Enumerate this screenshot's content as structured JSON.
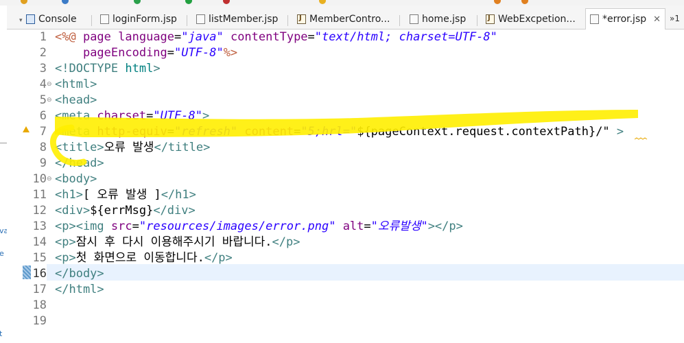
{
  "tabs": [
    {
      "label": "Console",
      "icon": "console-icon"
    },
    {
      "label": "loginForm.jsp",
      "icon": "file-icon"
    },
    {
      "label": "listMember.jsp",
      "icon": "file-icon"
    },
    {
      "label": "MemberContro...",
      "icon": "java-file-icon"
    },
    {
      "label": "home.jsp",
      "icon": "file-icon"
    },
    {
      "label": "WebExcpetion...",
      "icon": "java-file-icon"
    },
    {
      "label": "*error.jsp",
      "icon": "file-icon",
      "close": "✕",
      "active": true
    }
  ],
  "overflow_label": "»1",
  "left_strip": {
    "labels": [
      "va",
      "e",
      "t"
    ]
  },
  "editor": {
    "current_line": 16,
    "lines": [
      {
        "n": "1",
        "tokens": [
          [
            "dir",
            "<%@ "
          ],
          [
            "attr",
            "page "
          ],
          [
            "attr",
            "language"
          ],
          [
            "txt",
            "="
          ],
          [
            "val",
            "\"java\""
          ],
          [
            "txt",
            " "
          ],
          [
            "attr",
            "contentType"
          ],
          [
            "txt",
            "="
          ],
          [
            "val",
            "\"text/html; charset=UTF-8\""
          ]
        ]
      },
      {
        "n": "2",
        "tokens": [
          [
            "txt",
            "    "
          ],
          [
            "attr",
            "pageEncoding"
          ],
          [
            "txt",
            "="
          ],
          [
            "val",
            "\"UTF-8\""
          ],
          [
            "dir",
            "%>"
          ]
        ]
      },
      {
        "n": "3",
        "tokens": [
          [
            "tag",
            "<!DOCTYPE "
          ],
          [
            "doctype",
            "html"
          ],
          [
            "tag",
            ">"
          ]
        ]
      },
      {
        "n": "4",
        "fold": true,
        "tokens": [
          [
            "tag",
            "<html>"
          ]
        ]
      },
      {
        "n": "5",
        "fold": true,
        "tokens": [
          [
            "tag",
            "<head>"
          ]
        ]
      },
      {
        "n": "6",
        "tokens": [
          [
            "tag",
            "<meta "
          ],
          [
            "attr",
            "charset"
          ],
          [
            "txt",
            "="
          ],
          [
            "val",
            "\"UTF-8\""
          ],
          [
            "tag",
            ">"
          ]
        ]
      },
      {
        "n": "7",
        "warn": true,
        "tokens": [
          [
            "tag",
            "<meta "
          ],
          [
            "attr",
            "http-equiv"
          ],
          [
            "txt",
            "="
          ],
          [
            "val",
            "\"refresh\""
          ],
          [
            "txt",
            " "
          ],
          [
            "attr",
            "content"
          ],
          [
            "txt",
            "="
          ],
          [
            "val",
            "\"5;hrl=\""
          ],
          [
            "txt",
            "${pageContext.request.contextPath}/\""
          ],
          [
            "txt",
            " "
          ],
          [
            "tag",
            ">"
          ]
        ]
      },
      {
        "n": "8",
        "tokens": [
          [
            "tag",
            "<title>"
          ],
          [
            "txt",
            "오류 발생"
          ],
          [
            "tag",
            "</title>"
          ]
        ]
      },
      {
        "n": "9",
        "tokens": [
          [
            "tag",
            "</head>"
          ]
        ]
      },
      {
        "n": "10",
        "fold": true,
        "tokens": [
          [
            "tag",
            "<body>"
          ]
        ]
      },
      {
        "n": "11",
        "tokens": [
          [
            "tag",
            "<h1>"
          ],
          [
            "txt",
            "[ 오류 발생 ]"
          ],
          [
            "tag",
            "</h1>"
          ]
        ]
      },
      {
        "n": "12",
        "tokens": [
          [
            "tag",
            "<div>"
          ],
          [
            "txt",
            "${errMsg}"
          ],
          [
            "tag",
            "</div>"
          ]
        ]
      },
      {
        "n": "13",
        "tokens": [
          [
            "tag",
            "<p><img "
          ],
          [
            "attr",
            "src"
          ],
          [
            "txt",
            "="
          ],
          [
            "val",
            "\"resources/images/error.png\""
          ],
          [
            "txt",
            " "
          ],
          [
            "attr",
            "alt"
          ],
          [
            "txt",
            "="
          ],
          [
            "val",
            "\"오류발생\""
          ],
          [
            "tag",
            "></p>"
          ]
        ]
      },
      {
        "n": "14",
        "tokens": [
          [
            "tag",
            "<p>"
          ],
          [
            "txt",
            "잠시 후 다시 이용해주시기 바랍니다."
          ],
          [
            "tag",
            "</p>"
          ]
        ]
      },
      {
        "n": "15",
        "tokens": [
          [
            "tag",
            "<p>"
          ],
          [
            "txt",
            "첫 화면으로 이동합니다."
          ],
          [
            "tag",
            "</p>"
          ]
        ]
      },
      {
        "n": "16",
        "tokens": [
          [
            "tag",
            "</body>"
          ]
        ]
      },
      {
        "n": "17",
        "tokens": [
          [
            "tag",
            "</html>"
          ]
        ]
      },
      {
        "n": "18",
        "tokens": []
      },
      {
        "n": "19",
        "tokens": []
      }
    ]
  },
  "colors": {
    "tag": "#3f7f7f",
    "attr": "#7f007f",
    "val": "#2a00ff",
    "directive": "#bf5f3f",
    "highlighter": "#ffee00"
  }
}
